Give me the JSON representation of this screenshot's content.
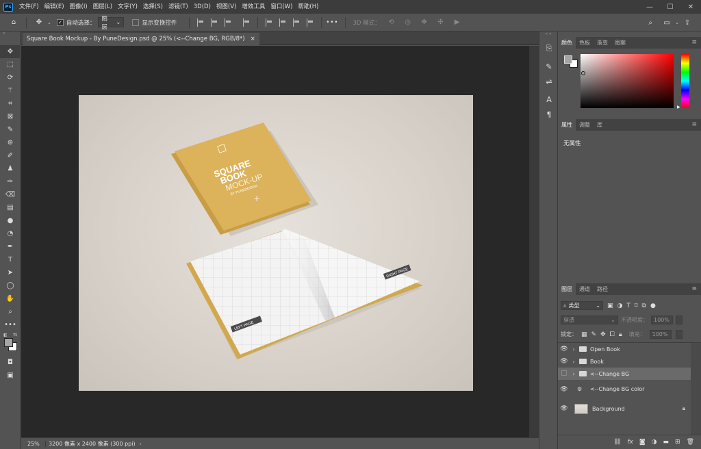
{
  "app": {
    "logo": "Ps"
  },
  "menu": [
    "文件(F)",
    "编辑(E)",
    "图像(I)",
    "图层(L)",
    "文字(Y)",
    "选择(S)",
    "滤镜(T)",
    "3D(D)",
    "视图(V)",
    "增效工具",
    "窗口(W)",
    "帮助(H)"
  ],
  "window_controls": {
    "minimize": "—",
    "maximize": "☐",
    "close": "✕"
  },
  "options": {
    "auto_select_label": "自动选择：",
    "auto_select_checked": true,
    "target_value": "图层",
    "show_transform_label": "显示变换控件",
    "mode_3d_label": "3D 模式：",
    "more": "•••"
  },
  "document": {
    "tab_title": "Square Book Mockup - By PuneDesign.psd @ 25% (<--Change BG, RGB/8*)",
    "close": "×"
  },
  "status": {
    "zoom": "25%",
    "info": "3200 像素 x 2400 像素 (300 ppi)",
    "arrow": "›"
  },
  "color_panel": {
    "tabs": [
      "颜色",
      "色板",
      "渐变",
      "图案"
    ],
    "active": 0,
    "foreground": "#a5a5a5",
    "background": "#ffffff"
  },
  "props_panel": {
    "tabs": [
      "属性",
      "调整",
      "库"
    ],
    "active": 0,
    "empty_text": "无属性"
  },
  "layers_panel": {
    "tabs": [
      "图层",
      "通道",
      "路径"
    ],
    "active": 0,
    "filter_label": "类型",
    "blend_mode": "穿透",
    "opacity_label": "不透明度：",
    "opacity_value": "100%",
    "lock_label": "锁定：",
    "fill_label": "填充：",
    "fill_value": "100%",
    "layers": [
      {
        "name": "Open Book",
        "type": "group",
        "visible": true
      },
      {
        "name": "Book",
        "type": "group",
        "visible": true
      },
      {
        "name": "<--Change BG",
        "type": "group",
        "visible": false,
        "selected": true
      },
      {
        "name": "<--Change BG color",
        "type": "adjustment",
        "visible": true
      },
      {
        "name": "Background",
        "type": "pixel",
        "visible": true,
        "locked": true
      }
    ],
    "footer_icons": [
      "link-icon",
      "fx-icon",
      "mask-icon",
      "adjustment-icon",
      "group-icon",
      "new-layer-icon",
      "trash-icon"
    ],
    "fx_label": "fx"
  },
  "artwork": {
    "book_title_lines": [
      "SQUARE",
      "BOOK",
      "MOCK-UP"
    ],
    "book_byline": "BY PUNEDESIGN",
    "left_page_label": "LEFT PAGE",
    "right_page_label": "RIGHT PAGE"
  },
  "colors": {
    "book_yellow": "#dcb25a",
    "ps_blue": "#31a8ff"
  }
}
